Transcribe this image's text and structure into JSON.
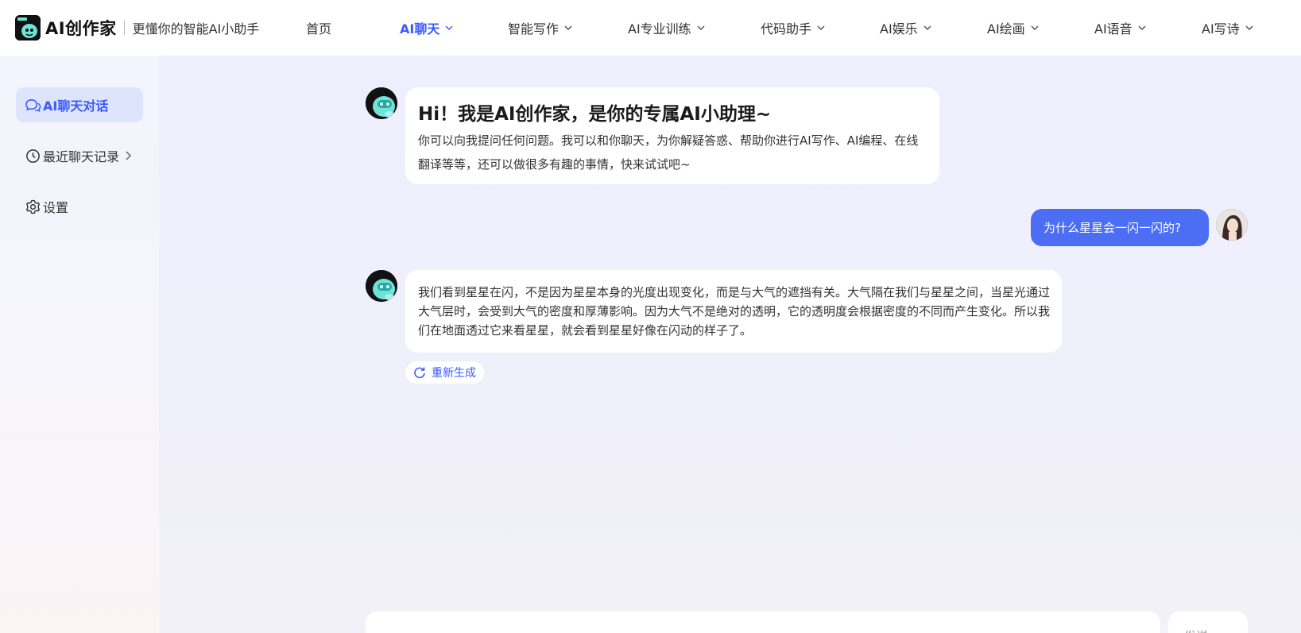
{
  "header": {
    "brand_name": "AI创作家",
    "slogan": "更懂你的智能AI小助手",
    "nav": [
      {
        "label": "首页",
        "has_dropdown": false,
        "active": false
      },
      {
        "label": "AI聊天",
        "has_dropdown": true,
        "active": true
      },
      {
        "label": "智能写作",
        "has_dropdown": true,
        "active": false
      },
      {
        "label": "AI专业训练",
        "has_dropdown": true,
        "active": false
      },
      {
        "label": "代码助手",
        "has_dropdown": true,
        "active": false
      },
      {
        "label": "AI娱乐",
        "has_dropdown": true,
        "active": false
      },
      {
        "label": "AI绘画",
        "has_dropdown": true,
        "active": false
      },
      {
        "label": "AI语音",
        "has_dropdown": true,
        "active": false
      },
      {
        "label": "AI写诗",
        "has_dropdown": true,
        "active": false
      }
    ]
  },
  "sidebar": {
    "items": [
      {
        "label": "AI聊天对话",
        "icon": "chat-bubble-icon",
        "active": true
      },
      {
        "label": "最近聊天记录",
        "icon": "clock-icon",
        "active": false
      },
      {
        "label": "设置",
        "icon": "gear-icon",
        "active": false
      }
    ]
  },
  "chat": {
    "greeting": {
      "title": "Hi！我是AI创作家，是你的专属AI小助理~",
      "body": "你可以向我提问任何问题。我可以和你聊天，为你解疑答惑、帮助你进行AI写作、AI编程、在线翻译等等，还可以做很多有趣的事情，快来试试吧~"
    },
    "user_message": "为什么星星会一闪一闪的?",
    "answer": "我们看到星星在闪，不是因为星星本身的光度出现变化，而是与大气的遮挡有关。大气隔在我们与星星之间，当星光通过大气层时，会受到大气的密度和厚薄影响。因为大气不是绝对的透明，它的透明度会根据密度的不同而产生变化。所以我们在地面透过它来看星星，就会看到星星好像在闪动的样子了。",
    "regenerate_label": "重新生成"
  },
  "composer": {
    "send_label": "发送"
  },
  "colors": {
    "accent": "#3d5afe",
    "user_bubble": "#4b6ef5",
    "active_side_bg": "#dde4fb"
  }
}
